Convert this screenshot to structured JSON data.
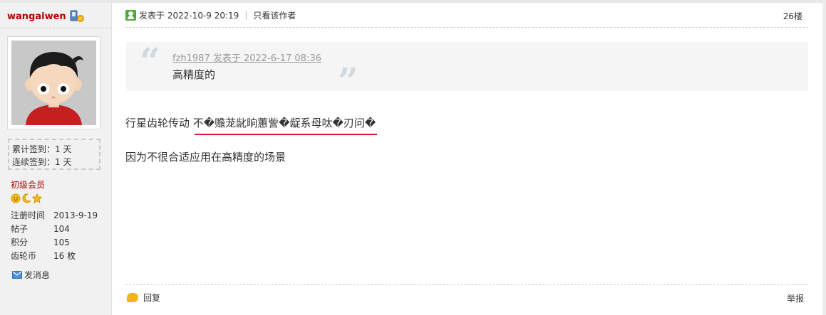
{
  "author": {
    "name": "wangaiwen"
  },
  "checkin": {
    "total": "累计签到：1 天",
    "streak": "连续签到：1 天"
  },
  "member": {
    "level": "初级会员",
    "info": [
      {
        "key": "注册时间",
        "value": "2013-9-19"
      },
      {
        "key": "帖子",
        "value": "104"
      },
      {
        "key": "积分",
        "value": "105"
      },
      {
        "key": "齿轮币",
        "value": "16 枚"
      }
    ],
    "message_link": "发消息"
  },
  "post": {
    "posted_at": "发表于 2022-10-9 20:19",
    "only_author": "只看该作者",
    "floor": "26楼",
    "quote": {
      "meta": "fzh1987 发表于 2022-6-17 08:36",
      "text": "高精度的"
    },
    "body_prefix": "行星齿轮传动 ",
    "body_garbled": "不�赡茏龀晌蕙訾�龊系母呔�刃问�",
    "body_line2": "因为不很合适应用在高精度的场景"
  },
  "footer": {
    "reply": "回复",
    "report": "举报"
  },
  "colors": {
    "author": "#b50000",
    "underline": "#d91e2a",
    "quote_bg": "#f5f5f5"
  }
}
